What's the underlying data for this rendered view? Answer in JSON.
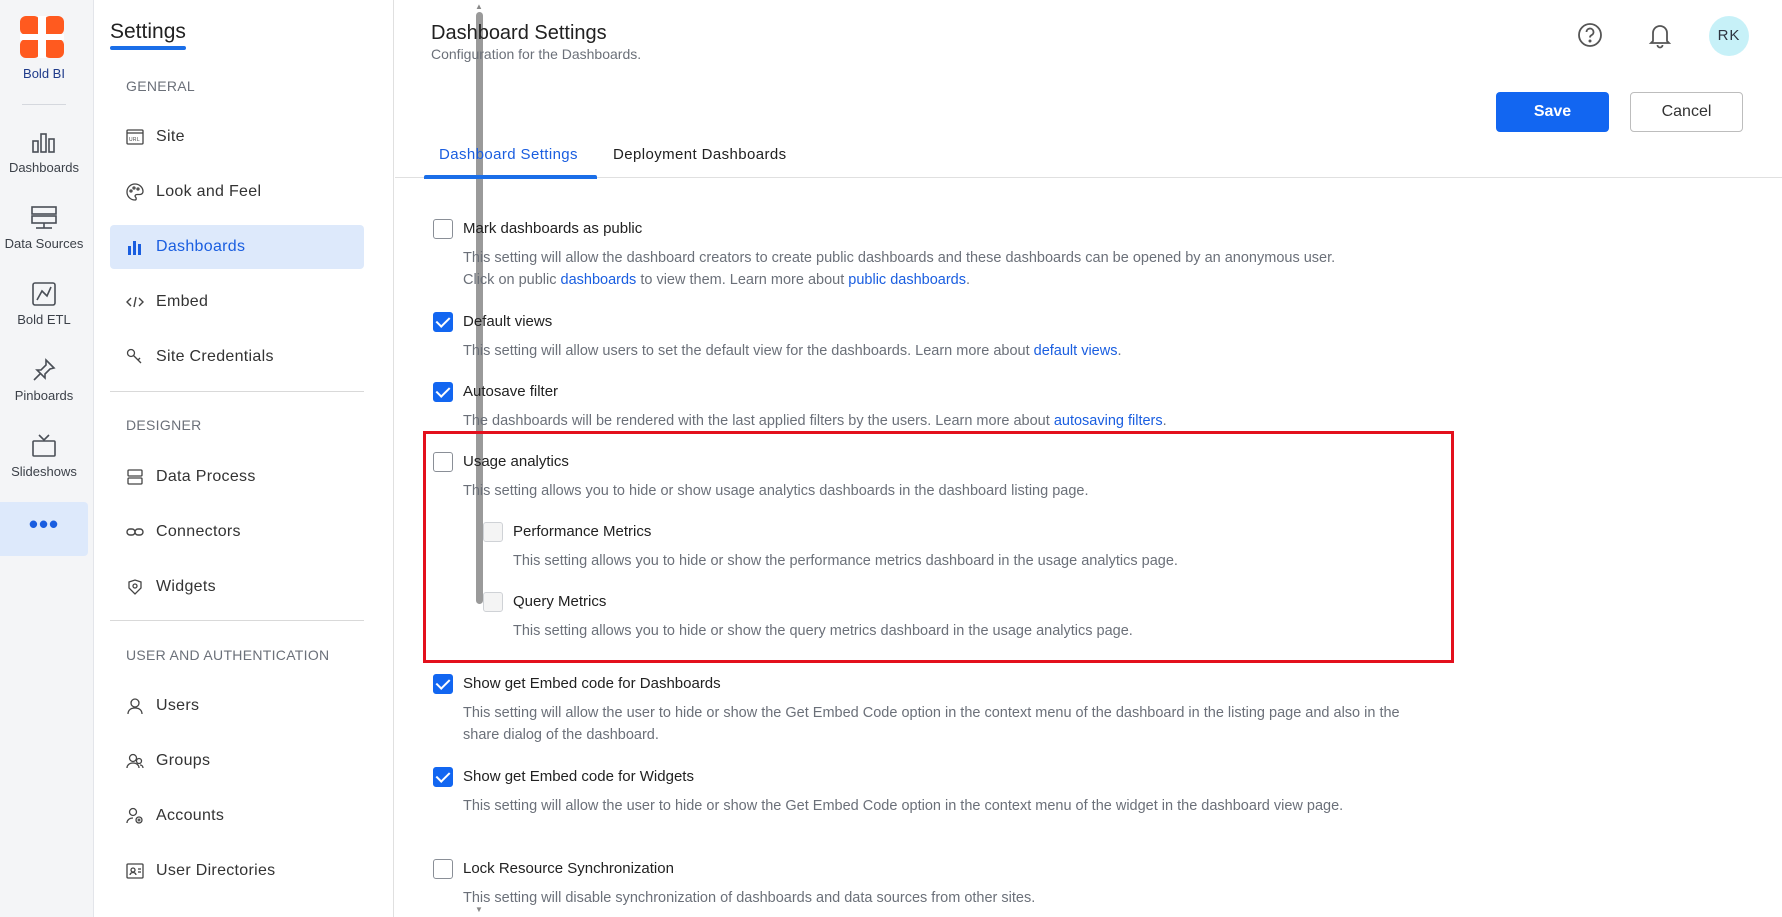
{
  "brand": {
    "name": "Bold BI",
    "color": "#ff5a1f"
  },
  "rail": {
    "items": [
      {
        "label": "Dashboards",
        "icon": "bar-chart-icon"
      },
      {
        "label": "Data Sources",
        "icon": "server-icon"
      },
      {
        "label": "Bold ETL",
        "icon": "etl-icon"
      },
      {
        "label": "Pinboards",
        "icon": "pin-icon"
      },
      {
        "label": "Slideshows",
        "icon": "tv-icon"
      }
    ],
    "more": "•••"
  },
  "nav": {
    "title": "Settings",
    "sections": {
      "general": "GENERAL",
      "designer": "DESIGNER",
      "user_auth": "USER AND AUTHENTICATION"
    },
    "items": [
      {
        "label": "Site",
        "icon": "url-icon"
      },
      {
        "label": "Look and Feel",
        "icon": "palette-icon"
      },
      {
        "label": "Dashboards",
        "icon": "bar-chart-icon"
      },
      {
        "label": "Embed",
        "icon": "code-icon"
      },
      {
        "label": "Site Credentials",
        "icon": "key-icon"
      },
      {
        "label": "Data Process",
        "icon": "database-icon"
      },
      {
        "label": "Connectors",
        "icon": "link-icon"
      },
      {
        "label": "Widgets",
        "icon": "widgets-icon"
      },
      {
        "label": "Users",
        "icon": "user-icon"
      },
      {
        "label": "Groups",
        "icon": "group-icon"
      },
      {
        "label": "Accounts",
        "icon": "account-icon"
      },
      {
        "label": "User Directories",
        "icon": "directory-icon"
      }
    ]
  },
  "header": {
    "title": "Dashboard Settings",
    "subtitle": "Configuration for the Dashboards.",
    "avatar": "RK",
    "save": "Save",
    "cancel": "Cancel"
  },
  "tabs": [
    {
      "label": "Dashboard Settings",
      "active": true
    },
    {
      "label": "Deployment Dashboards",
      "active": false
    }
  ],
  "settings": {
    "public": {
      "label": "Mark dashboards as public",
      "desc1": "This setting will allow the dashboard creators to create public dashboards and these dashboards can be opened by an anonymous user.",
      "desc2a": "Click on public ",
      "link1": "dashboards",
      "desc2b": " to view them. Learn more about ",
      "link2": "public dashboards",
      "desc2c": ".",
      "checked": false
    },
    "default_views": {
      "label": "Default views",
      "desc": "This setting will allow users to set the default view for the dashboards. Learn more about ",
      "link": "default views",
      "end": ".",
      "checked": true
    },
    "autosave": {
      "label": "Autosave filter",
      "desc": "The dashboards will be rendered with the last applied filters by the users. Learn more about ",
      "link": "autosaving filters",
      "end": ".",
      "checked": true
    },
    "usage": {
      "label": "Usage analytics",
      "desc": "This setting allows you to hide or show usage analytics dashboards in the dashboard listing page.",
      "checked": false
    },
    "performance": {
      "label": "Performance Metrics",
      "desc": "This setting allows you to hide or show the performance metrics dashboard in the usage analytics page.",
      "checked": false
    },
    "query": {
      "label": "Query Metrics",
      "desc": "This setting allows you to hide or show the query metrics dashboard in the usage analytics page.",
      "checked": false
    },
    "embed_dash": {
      "label": "Show get Embed code for Dashboards",
      "desc": "This setting will allow the user to hide or show the Get Embed Code option in the context menu of the dashboard in the listing page and also in the share dialog of the dashboard.",
      "checked": true
    },
    "embed_widget": {
      "label": "Show get Embed code for Widgets",
      "desc": "This setting will allow the user to hide or show the Get Embed Code option in the context menu of the widget in the dashboard view page.",
      "checked": true
    },
    "lock": {
      "label": "Lock Resource Synchronization",
      "desc": "This setting will disable synchronization of dashboards and data sources from other sites.",
      "checked": false
    }
  },
  "colors": {
    "accent": "#1266f1",
    "highlight": "#e3101d",
    "active_bg": "#dde9fb"
  }
}
